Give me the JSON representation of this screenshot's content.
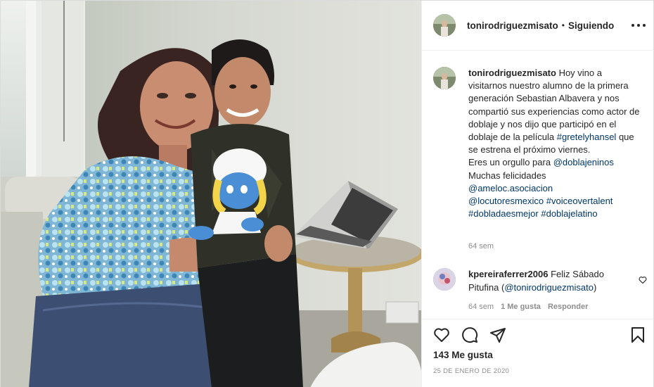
{
  "post": {
    "photo_alt": "",
    "header": {
      "username": "tonirodriguezmisato",
      "separator": "•",
      "follow_label": "Siguiendo",
      "more_icon": "more-horizontal-icon"
    },
    "caption": {
      "username": "tonirodriguezmisato",
      "text_parts": {
        "p1": " Hoy vino a visitarnos nuestro alumno de la primera generación Sebastian Albavera y nos compartió sus experiencias como actor de doblaje y nos dijo que participó en el doblaje de la película ",
        "tag1": "#gretelyhansel",
        "p2": " que se estrena el próximo viernes.\nEres un orgullo para ",
        "m1": "@doblajeninos",
        "p3": "\nMuchas felicidades\n",
        "m2": "@ameloc.asociacion",
        "p4": "\n",
        "m3": "@locutoresmexico",
        "p5": " ",
        "tag2": "#voiceovertalent",
        "p6": "\n",
        "tag3": "#dobladaesmejor",
        "p7": " ",
        "tag4": "#doblajelatino"
      },
      "age": "64 sem"
    },
    "comment": {
      "username": "kpereiraferrer2006",
      "text": " Feliz Sábado Pitufina (",
      "mention": "@tonirodriguezmisato",
      "text_end": ")",
      "age": "64 sem",
      "likes": "1 Me gusta",
      "reply_label": "Responder",
      "like_icon": "heart-outline-icon"
    },
    "actions": {
      "like_icon": "heart-outline-icon",
      "comment_icon": "comment-bubble-icon",
      "share_icon": "paper-plane-icon",
      "save_icon": "bookmark-icon",
      "likes_text": "143 Me gusta",
      "date_text": "25 DE ENERO DE 2020"
    },
    "colors": {
      "text": "#262626",
      "link": "#00376b",
      "muted": "#8e8e8e",
      "border": "#efefef"
    }
  }
}
